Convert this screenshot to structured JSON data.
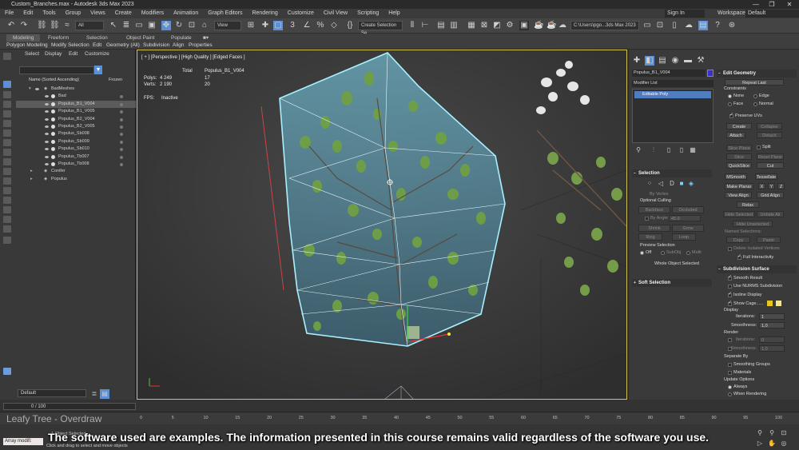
{
  "window": {
    "title": "Custom_Branches.max - Autodesk 3ds Max 2023"
  },
  "menu": {
    "items": [
      "File",
      "Edit",
      "Tools",
      "Group",
      "Views",
      "Create",
      "Modifiers",
      "Animation",
      "Graph Editors",
      "Rendering",
      "Customize",
      "Civil View",
      "Scripting",
      "Help"
    ]
  },
  "account": {
    "sign_in": "Sign In",
    "workspaces_label": "Workspaces:",
    "workspace": "Default"
  },
  "toolbar": {
    "filter": "All",
    "ref_coord": "View",
    "selection_set": "Create Selection Se",
    "path": "C:\\Users\\pgo...3ds Max 2023"
  },
  "ribbon": {
    "tabs": [
      "Modeling",
      "Freeform",
      "Selection",
      "Object Paint",
      "Populate"
    ],
    "subtabs": [
      "Polygon Modeling",
      "Modify Selection",
      "Edit",
      "Geometry (All)",
      "Subdivision",
      "Align",
      "Properties"
    ]
  },
  "scene": {
    "menu": [
      "Select",
      "Display",
      "Edit",
      "Customize"
    ],
    "col_name": "Name (Sorted Ascending)",
    "col_frozen": "Frozen",
    "rows": [
      "BadMeshes",
      "Bad",
      "Populus_B1_V004",
      "Populus_B1_V005",
      "Populus_B2_V004",
      "Populus_B2_V005",
      "Populus_Sb008",
      "Populus_Sb009",
      "Populus_Sb010",
      "Populus_Tb007",
      "Populus_Tb008",
      "Conifer",
      "Populus"
    ],
    "layer": "Default",
    "frame": "0 / 100"
  },
  "viewport": {
    "label": "[ + ] [Perspective ] [High Quality ] [Edged Faces ]",
    "stats_total": "Total",
    "stats_obj": "Populus_B1_V004",
    "polys_label": "Polys:",
    "polys_total": "4 249",
    "polys_obj": "17",
    "verts_label": "Verts:",
    "verts_total": "2 190",
    "verts_obj": "20",
    "fps_label": "FPS:",
    "fps_value": "Inactive"
  },
  "command_panel": {
    "object_name": "Populus_B1_V004",
    "object_color": "#3b2fc9",
    "modifier_list": "Modifier List",
    "stack_item": "Editable Poly",
    "selection": {
      "title": "Selection",
      "by_vertex": "By Vertex",
      "optional_culling": "Optional Culling",
      "backface": "Backface",
      "occluded": "Occluded",
      "by_angle": "By Angle:",
      "angle": "45.0",
      "shrink": "Shrink",
      "grow": "Grow",
      "ring": "Ring",
      "loop": "Loop",
      "preview": "Preview Selection",
      "off": "Off",
      "subobj": "SubObj",
      "multi": "Multi",
      "whole": "Whole Object Selected"
    },
    "soft_selection": "Soft Selection",
    "edit_geometry": {
      "title": "Edit Geometry",
      "repeat_last": "Repeat Last",
      "constraints": "Constraints",
      "none": "None",
      "edge": "Edge",
      "face": "Face",
      "normal": "Normal",
      "preserve_uvs": "Preserve UVs",
      "create": "Create",
      "collapse": "Collapse",
      "attach": "Attach",
      "detach": "Detach",
      "slice_plane": "Slice Plane",
      "split": "Split",
      "slice": "Slice",
      "reset_plane": "Reset Plane",
      "quickslice": "QuickSlice",
      "cut": "Cut",
      "msmooth": "MSmooth",
      "tessellate": "Tessellate",
      "make_planar": "Make Planar",
      "x": "X",
      "y": "Y",
      "z": "Z",
      "view_align": "View Align",
      "grid_align": "Grid Align",
      "relax": "Relax",
      "hide_selected": "Hide Selected",
      "unhide_all": "Unhide All",
      "hide_unselected": "Hide Unselected",
      "named_selections": "Named Selections:",
      "copy": "Copy",
      "paste": "Paste",
      "delete_isolated": "Delete Isolated Vertices",
      "full_interactivity": "Full Interactivity"
    },
    "subdivision": {
      "title": "Subdivision Surface",
      "smooth_result": "Smooth Result",
      "use_nurms": "Use NURMS Subdivision",
      "isoline": "Isoline Display",
      "show_cage": "Show Cage......",
      "display": "Display",
      "iterations": "Iterations:",
      "iterations_val": "1",
      "smoothness": "Smoothness:",
      "smoothness_val": "1,0",
      "render": "Render",
      "r_iterations_val": "0",
      "r_smoothness_val": "1,0",
      "separate_by": "Separate By",
      "smoothing_groups": "Smoothing Groups",
      "materials": "Materials",
      "update_options": "Update Options",
      "always": "Always",
      "when_rendering": "When Rendering"
    }
  },
  "timeline": {
    "ticks": [
      "0",
      "5",
      "10",
      "15",
      "20",
      "25",
      "30",
      "35",
      "40",
      "45",
      "50",
      "55",
      "60",
      "65",
      "70",
      "75",
      "80",
      "85",
      "90",
      "95",
      "100"
    ],
    "status": "1 Object Selected",
    "prompt": "Click and drag to select and move objects",
    "maxscript": "Array modifi:"
  },
  "overlay": {
    "title": "Leafy Tree - Overdraw",
    "caption": "The software used are examples. The information presented in this course remains valid regardless of the software you use."
  }
}
